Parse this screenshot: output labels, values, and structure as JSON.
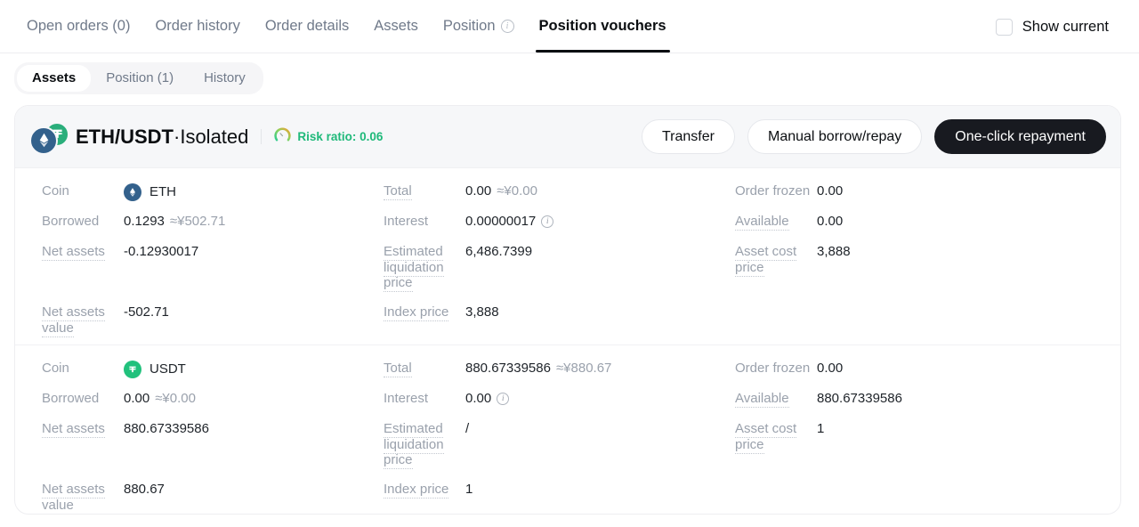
{
  "topbar": {
    "tabs": [
      {
        "label": "Open orders (0)",
        "active": false,
        "icon": null
      },
      {
        "label": "Order history",
        "active": false,
        "icon": null
      },
      {
        "label": "Order details",
        "active": false,
        "icon": null
      },
      {
        "label": "Assets",
        "active": false,
        "icon": null
      },
      {
        "label": "Position",
        "active": false,
        "icon": "info-icon"
      },
      {
        "label": "Position vouchers",
        "active": true,
        "icon": null
      }
    ],
    "show_current_label": "Show current",
    "show_current_checked": false
  },
  "subtabs": [
    {
      "label": "Assets",
      "active": true
    },
    {
      "label": "Position (1)",
      "active": false
    },
    {
      "label": "History",
      "active": false
    }
  ],
  "card": {
    "pair": "ETH/USDT",
    "separator": "·",
    "mode": "Isolated",
    "risk_label": "Risk ratio: 0.06",
    "risk_color": "#1fb97a",
    "buttons": [
      {
        "label": "Transfer",
        "style": "outline"
      },
      {
        "label": "Manual borrow/repay",
        "style": "outline"
      },
      {
        "label": "One-click repayment",
        "style": "dark"
      }
    ],
    "rows": [
      {
        "coin_label": "Coin",
        "coin_name": "ETH",
        "coin_icon": "eth-icon",
        "coin_color": "#33618c",
        "left": [
          {
            "label": "Borrowed",
            "dotted": false,
            "value": "0.1293",
            "approx": "≈¥502.71"
          },
          {
            "label": "Net assets",
            "dotted": true,
            "value": "-0.12930017",
            "approx": "",
            "tall": true
          },
          {
            "label": "Net assets value",
            "dotted": true,
            "value": "-502.71",
            "approx": ""
          }
        ],
        "mid": [
          {
            "label": "Total",
            "dotted": true,
            "value": "0.00",
            "approx": "≈¥0.00"
          },
          {
            "label": "Interest",
            "dotted": false,
            "value": "0.00000017",
            "approx": "",
            "info": true
          },
          {
            "label": "Estimated liquidation price",
            "dotted": true,
            "value": "6,486.7399",
            "approx": "",
            "tall": true
          },
          {
            "label": "Index price",
            "dotted": true,
            "value": "3,888",
            "approx": ""
          }
        ],
        "right": [
          {
            "label": "Order frozen",
            "dotted": false,
            "value": "0.00",
            "approx": ""
          },
          {
            "label": "Available",
            "dotted": true,
            "value": "0.00",
            "approx": ""
          },
          {
            "label": "Asset cost price",
            "dotted": true,
            "value": "3,888",
            "approx": "",
            "tall": true
          }
        ]
      },
      {
        "coin_label": "Coin",
        "coin_name": "USDT",
        "coin_icon": "usdt-icon",
        "coin_color": "#21c17c",
        "left": [
          {
            "label": "Borrowed",
            "dotted": false,
            "value": "0.00",
            "approx": "≈¥0.00"
          },
          {
            "label": "Net assets",
            "dotted": true,
            "value": "880.67339586",
            "approx": "",
            "tall": true
          },
          {
            "label": "Net assets value",
            "dotted": true,
            "value": "880.67",
            "approx": ""
          }
        ],
        "mid": [
          {
            "label": "Total",
            "dotted": true,
            "value": "880.67339586",
            "approx": "≈¥880.67"
          },
          {
            "label": "Interest",
            "dotted": false,
            "value": "0.00",
            "approx": "",
            "info": true
          },
          {
            "label": "Estimated liquidation price",
            "dotted": true,
            "value": "/",
            "approx": "",
            "tall": true
          },
          {
            "label": "Index price",
            "dotted": true,
            "value": "1",
            "approx": ""
          }
        ],
        "right": [
          {
            "label": "Order frozen",
            "dotted": false,
            "value": "0.00",
            "approx": ""
          },
          {
            "label": "Available",
            "dotted": true,
            "value": "880.67339586",
            "approx": ""
          },
          {
            "label": "Asset cost price",
            "dotted": true,
            "value": "1",
            "approx": "",
            "tall": true
          }
        ]
      }
    ]
  }
}
